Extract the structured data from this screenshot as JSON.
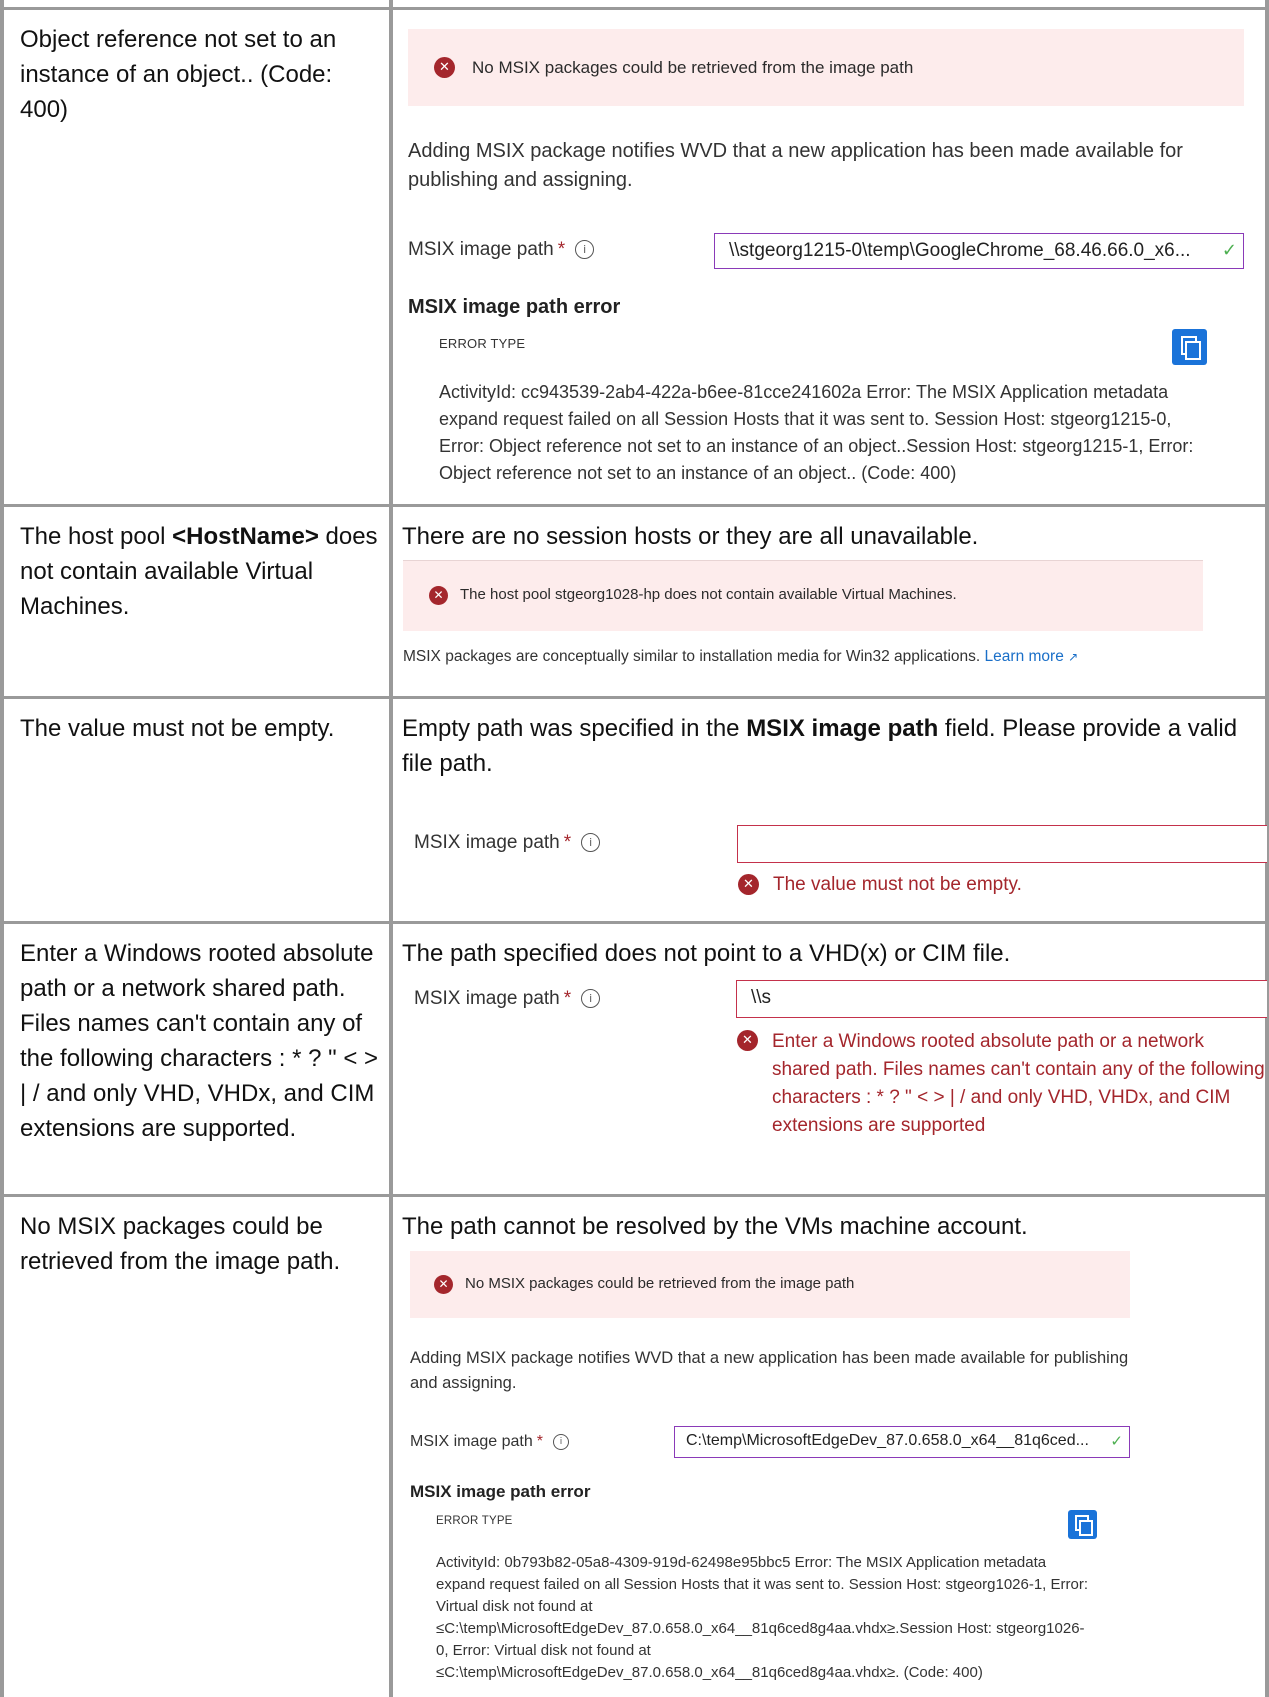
{
  "rows": [
    {
      "left": "Object reference not set to an instance of an object.. (Code: 400)",
      "banner": "No MSIX packages could be retrieved from the image path",
      "description": "Adding MSIX package notifies WVD that a new application has been made available for publishing and assigning.",
      "field_label": "MSIX image path",
      "required_mark": "*",
      "info_glyph": "i",
      "field_value": "\\\\stgeorg1215-0\\temp\\GoogleChrome_68.46.66.0_x6...",
      "error_title": "MSIX image path error",
      "error_type": "ERROR TYPE",
      "error_detail": "ActivityId: cc943539-2ab4-422a-b6ee-81cce241602a Error: The MSIX Application metadata expand request failed on all Session Hosts that it was sent to. Session Host: stgeorg1215-0, Error: Object reference not set to an instance of an object..Session Host: stgeorg1215-1, Error: Object reference not set to an instance of an object.. (Code: 400)"
    },
    {
      "left_prefix": "The host pool ",
      "left_bold": "<HostName>",
      "left_suffix": " does not contain available Virtual Machines.",
      "heading": "There are no session hosts or they are all unavailable.",
      "banner": "The host pool stgeorg1028-hp does not contain available Virtual Machines.",
      "note": "MSIX packages are conceptually similar to installation media for Win32 applications.",
      "learn_more": "Learn more"
    },
    {
      "left": "The value must not be empty.",
      "heading_prefix": "Empty path was specified in the ",
      "heading_bold": "MSIX image path",
      "heading_suffix": " field. Please provide a valid file path.",
      "field_label": "MSIX image path",
      "required_mark": "*",
      "info_glyph": "i",
      "field_value": "",
      "validation": "The value must not be empty."
    },
    {
      "left": "Enter a Windows rooted absolute path or a network shared path. Files names can't contain any of the following characters : * ? \" < > | / and only VHD, VHDx, and CIM extensions are supported.",
      "heading": "The path specified does not point to a VHD(x) or CIM file.",
      "field_label": "MSIX image path",
      "required_mark": "*",
      "info_glyph": "i",
      "field_value": "\\\\s",
      "validation": "Enter a Windows rooted absolute path or a network shared path. Files names can't contain any of the following characters : * ? \" < > | / and only VHD, VHDx, and CIM extensions are supported"
    },
    {
      "left": "No MSIX packages could be retrieved from the image path.",
      "heading": "The path cannot be resolved by the VMs machine account.",
      "banner": "No MSIX packages could be retrieved from the image path",
      "description": "Adding MSIX package notifies WVD that a new application has been made available for publishing and assigning.",
      "field_label": "MSIX image path",
      "required_mark": "*",
      "info_glyph": "i",
      "field_value": "C:\\temp\\MicrosoftEdgeDev_87.0.658.0_x64__81q6ced...",
      "error_title": "MSIX image path error",
      "error_type": "ERROR TYPE",
      "error_detail": "ActivityId: 0b793b82-05a8-4309-919d-62498e95bbc5 Error: The MSIX Application metadata expand request failed on all Session Hosts that it was sent to. Session Host: stgeorg1026-1, Error: Virtual disk not found at ≤C:\\temp\\MicrosoftEdgeDev_87.0.658.0_x64__81q6ced8g4aa.vhdx≥.Session Host: stgeorg1026-0, Error: Virtual disk not found at ≤C:\\temp\\MicrosoftEdgeDev_87.0.658.0_x64__81q6ced8g4aa.vhdx≥. (Code: 400)"
    }
  ],
  "icons": {
    "error": "error-circle-icon",
    "info": "info-circle-icon",
    "check": "checkmark-icon",
    "copy": "copy-icon",
    "external": "external-link-icon"
  },
  "colors": {
    "banner_bg": "#fdecec",
    "error_red": "#a4262c",
    "input_border": "#8a3ab8",
    "copy_blue": "#1a73d9",
    "link_blue": "#1a6fc8",
    "grid": "#9a9a9a"
  }
}
